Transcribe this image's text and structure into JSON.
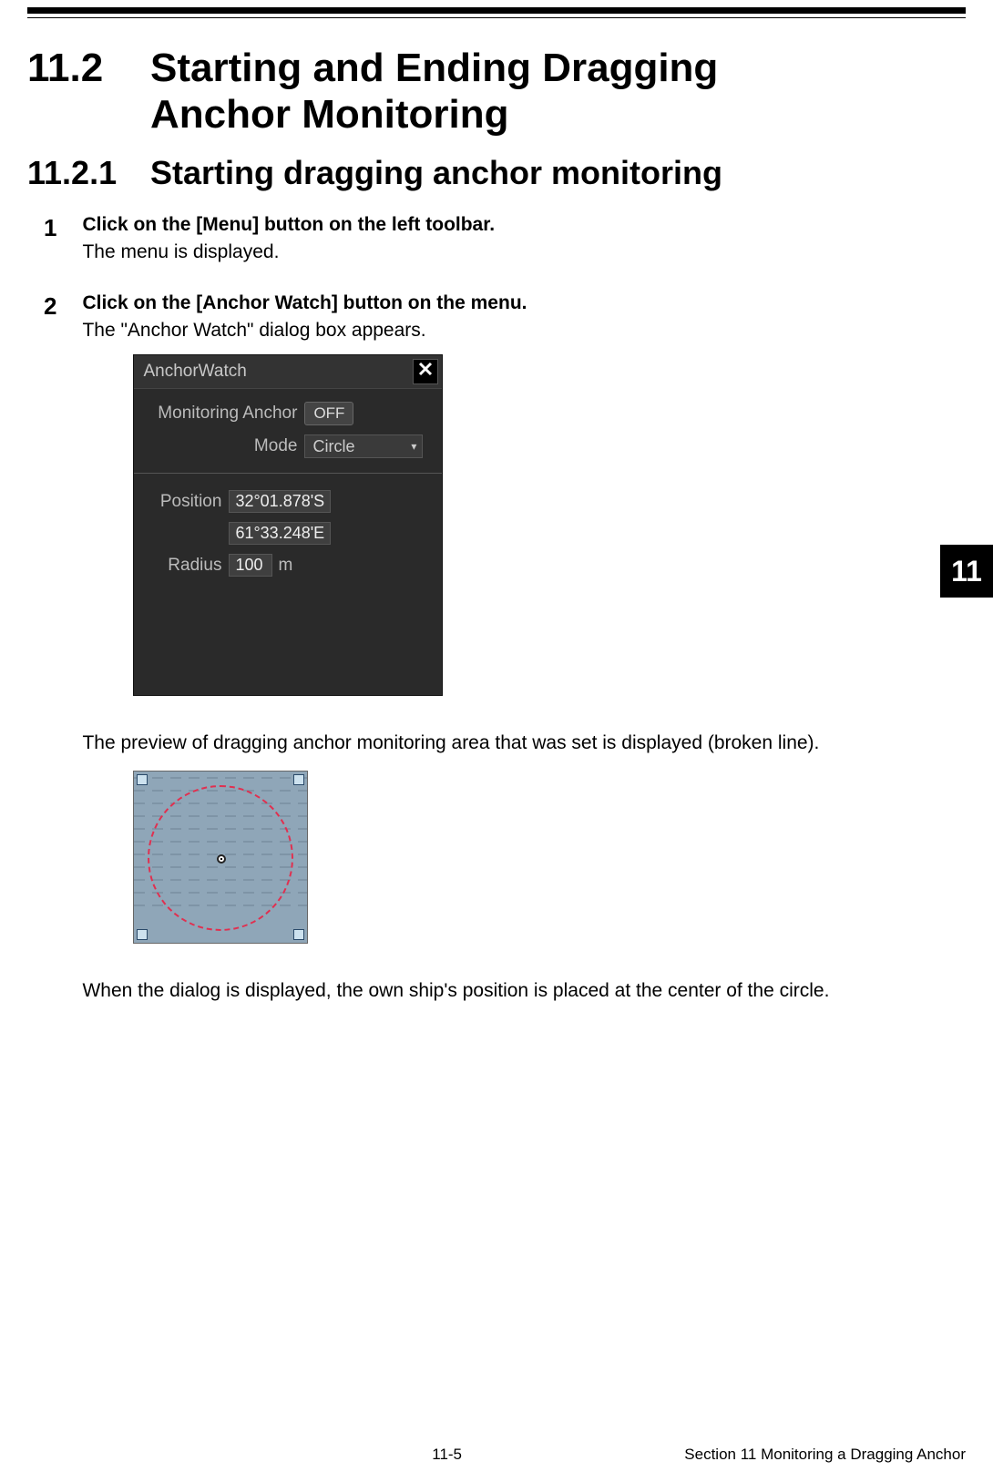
{
  "heading": {
    "number": "11.2",
    "title": "Starting and Ending Dragging Anchor Monitoring"
  },
  "subheading": {
    "number": "11.2.1",
    "title": "Starting dragging anchor monitoring"
  },
  "steps": [
    {
      "num": "1",
      "title": "Click on the [Menu] button on the left toolbar.",
      "desc": "The menu is displayed."
    },
    {
      "num": "2",
      "title": "Click on the [Anchor Watch] button on the menu.",
      "desc": "The \"Anchor Watch\" dialog box appears."
    }
  ],
  "dialog": {
    "title": "AnchorWatch",
    "monitoring_label": "Monitoring Anchor",
    "monitoring_value": "OFF",
    "mode_label": "Mode",
    "mode_value": "Circle",
    "position_label": "Position",
    "position_lat": "32°01.878'S",
    "position_lon": "61°33.248'E",
    "radius_label": "Radius",
    "radius_value": "100",
    "radius_unit": "m"
  },
  "body": {
    "preview_text": "The preview of dragging anchor monitoring area that was set is displayed (broken line).",
    "center_text": "When the dialog is displayed, the own ship's position is placed at the center of the circle."
  },
  "sidetab": "11",
  "footer": {
    "page": "11-5",
    "section": "Section 11    Monitoring a Dragging Anchor"
  }
}
